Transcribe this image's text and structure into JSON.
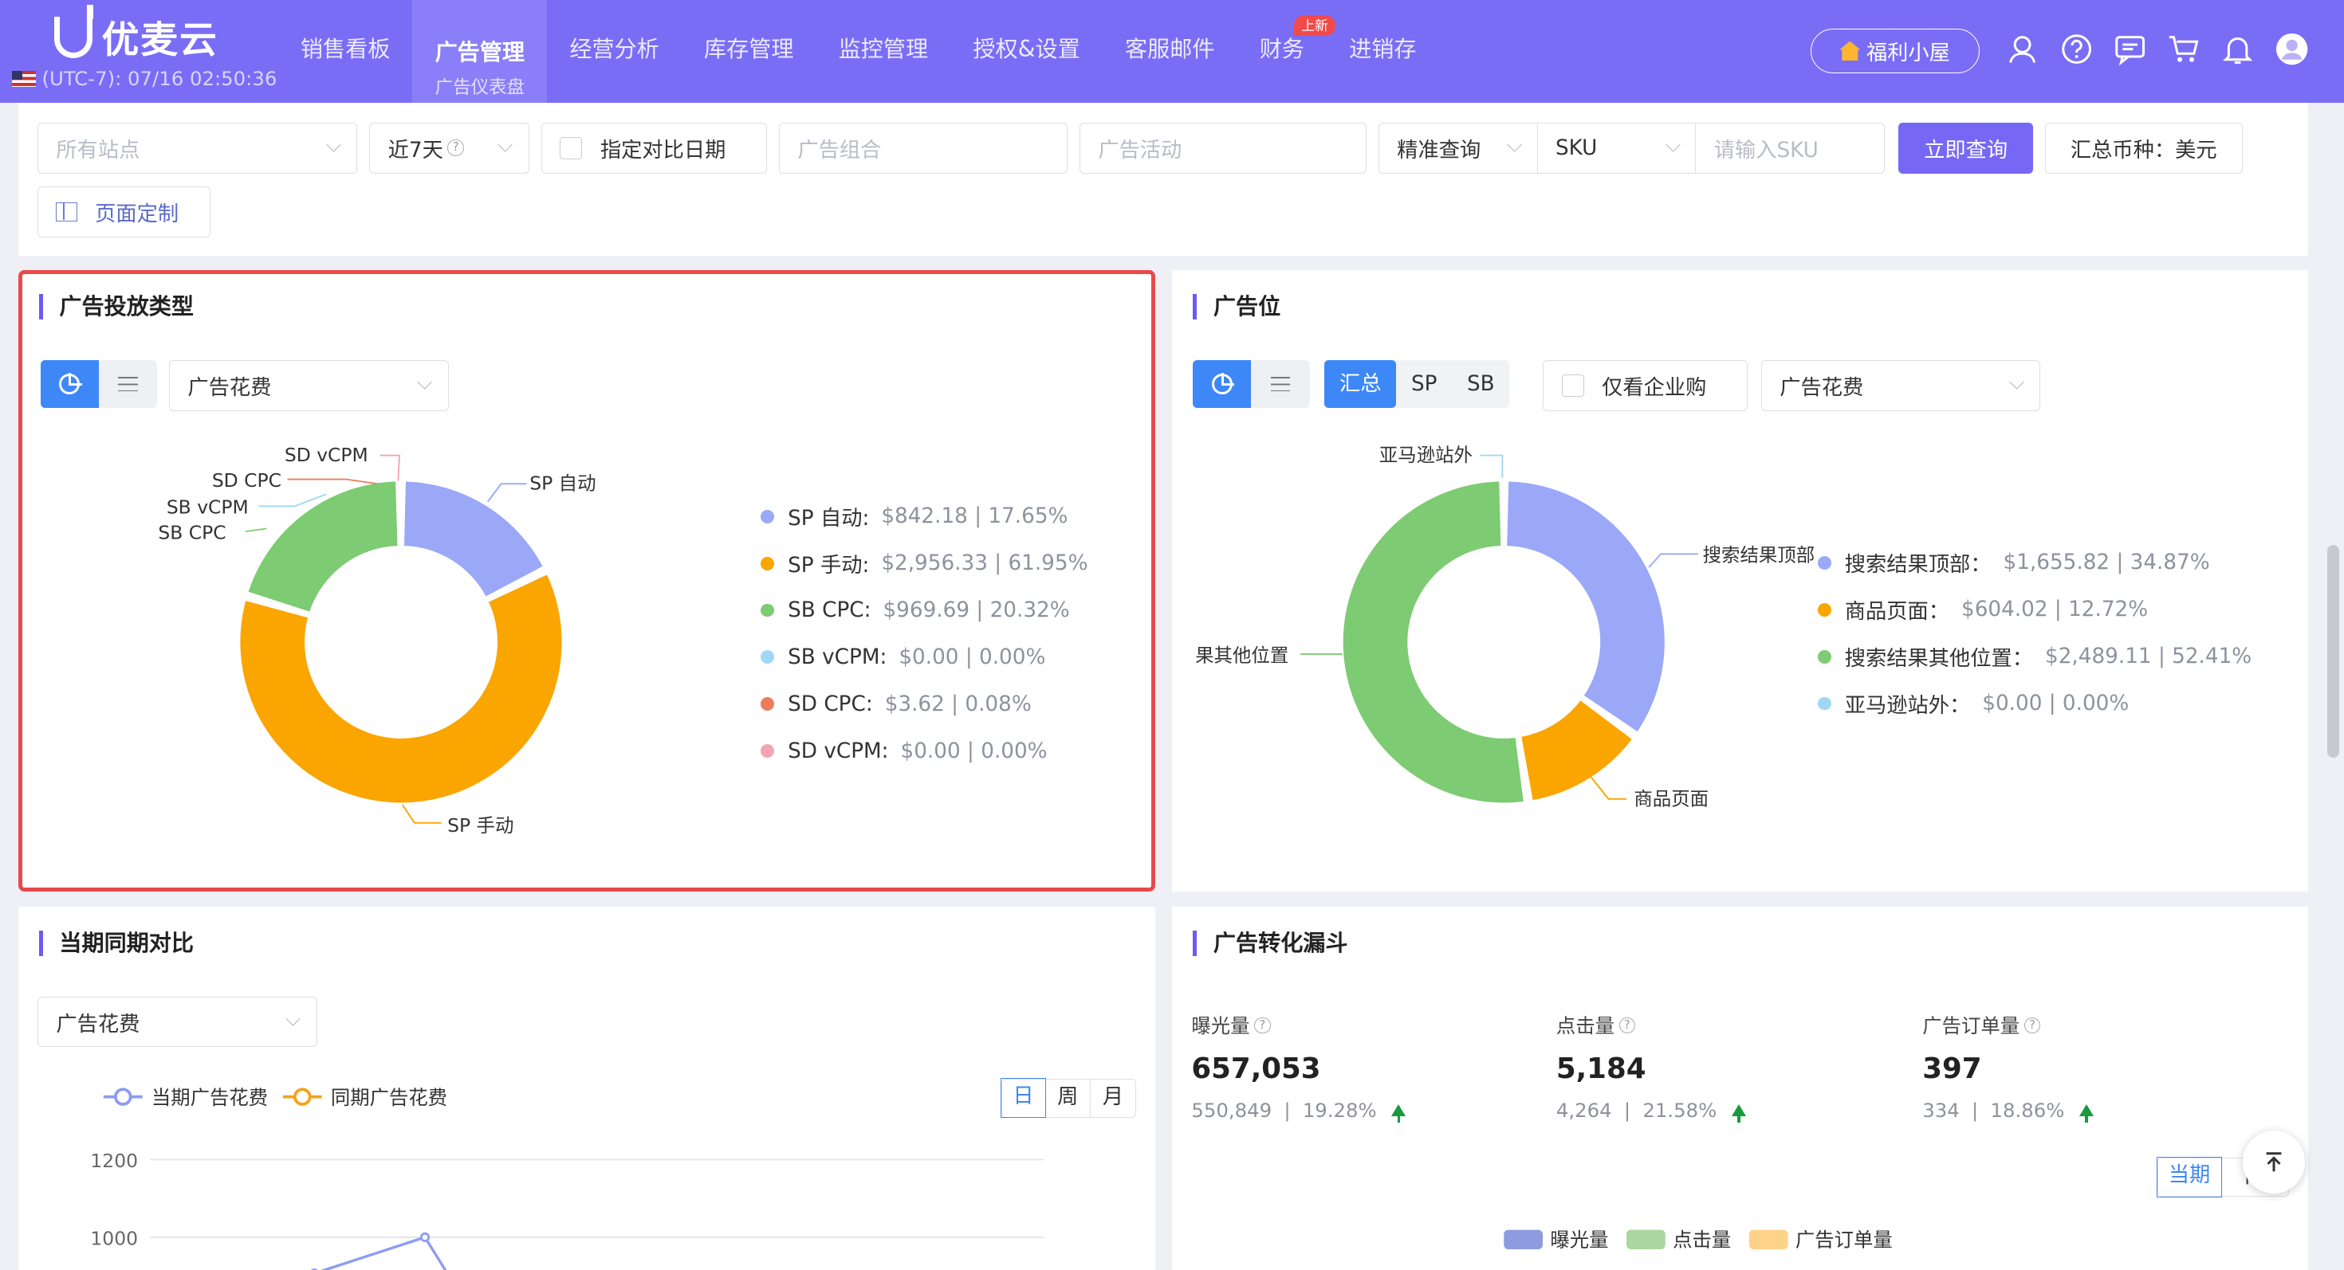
{
  "header": {
    "logo_text": "优麦云",
    "timezone": "(UTC-7): 07/16 02:50:36",
    "nav": [
      {
        "label": "销售看板"
      },
      {
        "label": "广告管理",
        "sub": "广告仪表盘",
        "active": true
      },
      {
        "label": "经营分析"
      },
      {
        "label": "库存管理"
      },
      {
        "label": "监控管理"
      },
      {
        "label": "授权&设置"
      },
      {
        "label": "客服邮件"
      },
      {
        "label": "财务",
        "badge": "上新"
      },
      {
        "label": "进销存"
      }
    ],
    "welfare_label": "福利小屋",
    "icons": [
      "user-support-icon",
      "help-icon",
      "message-icon",
      "cart-icon",
      "bell-icon",
      "avatar-icon"
    ]
  },
  "filters": {
    "site_placeholder": "所有站点",
    "date_range": "近7天",
    "compare_date_label": "指定对比日期",
    "ad_group_placeholder": "广告组合",
    "campaign_placeholder": "广告活动",
    "match_mode": "精准查询",
    "field": "SKU",
    "sku_placeholder": "请输入SKU",
    "query_button": "立即查询",
    "currency_label": "汇总币种：美元",
    "customize_button": "页面定制"
  },
  "ad_type_panel": {
    "title": "广告投放类型",
    "metric_select": "广告花费",
    "chart_data": {
      "type": "pie",
      "title": "",
      "categories": [
        "SP 自动",
        "SP 手动",
        "SB CPC",
        "SB vCPM",
        "SD CPC",
        "SD vCPM"
      ],
      "values": [
        842.18,
        2956.33,
        969.69,
        0.0,
        3.62,
        0.0
      ],
      "percents": [
        17.65,
        61.95,
        20.32,
        0.0,
        0.08,
        0.0
      ],
      "colors": [
        "#9aa8f7",
        "#faa500",
        "#7dcb72",
        "#9fd8f7",
        "#ed7d5a",
        "#f5a5b1"
      ],
      "legend_position": "right"
    },
    "callouts": [
      "SP 自动",
      "SP 手动",
      "SB CPC",
      "SB vCPM",
      "SD CPC",
      "SD vCPM"
    ],
    "legend": [
      {
        "name": "SP 自动:",
        "value": "$842.18 | 17.65%"
      },
      {
        "name": "SP 手动:",
        "value": "$2,956.33 | 61.95%"
      },
      {
        "name": "SB CPC:",
        "value": "$969.69 | 20.32%"
      },
      {
        "name": "SB vCPM:",
        "value": "$0.00 | 0.00%"
      },
      {
        "name": "SD CPC:",
        "value": "$3.62 | 0.08%"
      },
      {
        "name": "SD vCPM:",
        "value": "$0.00 | 0.00%"
      }
    ]
  },
  "placement_panel": {
    "title": "广告位",
    "segments": [
      "汇总",
      "SP",
      "SB"
    ],
    "business_only_label": "仅看企业购",
    "metric_select": "广告花费",
    "chart_data": {
      "type": "pie",
      "title": "",
      "categories": [
        "搜索结果顶部",
        "商品页面",
        "搜索结果其他位置",
        "亚马逊站外"
      ],
      "values": [
        1655.82,
        604.02,
        2489.11,
        0.0
      ],
      "percents": [
        34.87,
        12.72,
        52.41,
        0.0
      ],
      "colors": [
        "#9aa8f7",
        "#faa500",
        "#7dcb72",
        "#9fd8f7"
      ],
      "legend_position": "right"
    },
    "callouts": [
      "亚马逊站外",
      "搜索结果顶部",
      "果其他位置",
      "商品页面"
    ],
    "legend": [
      {
        "name": "搜索结果顶部：",
        "value": "$1,655.82 | 34.87%"
      },
      {
        "name": "商品页面：",
        "value": "$604.02 | 12.72%"
      },
      {
        "name": "搜索结果其他位置：",
        "value": "$2,489.11 | 52.41%"
      },
      {
        "name": "亚马逊站外：",
        "value": "$0.00 | 0.00%"
      }
    ]
  },
  "period_panel": {
    "title": "当期同期对比",
    "metric_select": "广告花费",
    "series_labels": [
      "当期广告花费",
      "同期广告花费"
    ],
    "series_colors": [
      "#8c9cf2",
      "#f7a21b"
    ],
    "granularity": [
      "日",
      "周",
      "月"
    ],
    "chart_data": {
      "type": "line",
      "title": "",
      "y_ticks": [
        "1200",
        "1000"
      ],
      "ylim": [
        1000,
        1200
      ],
      "series": [
        {
          "name": "当期广告花费",
          "values": [
            980,
            1000
          ]
        },
        {
          "name": "同期广告花费",
          "values": []
        }
      ]
    }
  },
  "funnel_panel": {
    "title": "广告转化漏斗",
    "kpis": [
      {
        "label": "曝光量",
        "value": "657,053",
        "prev": "550,849",
        "change": "19.28%"
      },
      {
        "label": "点击量",
        "value": "5,184",
        "prev": "4,264",
        "change": "21.58%"
      },
      {
        "label": "广告订单量",
        "value": "397",
        "prev": "334",
        "change": "18.86%"
      }
    ],
    "period_tabs": [
      "当期",
      "同"
    ],
    "chart_data": {
      "type": "bar",
      "title": "",
      "series": [
        {
          "name": "曝光量"
        },
        {
          "name": "点击量"
        },
        {
          "name": "广告订单量"
        }
      ],
      "colors": [
        "#8c9cdf",
        "#a9d79f",
        "#ffd28a"
      ],
      "legend_position": "bottom"
    }
  }
}
